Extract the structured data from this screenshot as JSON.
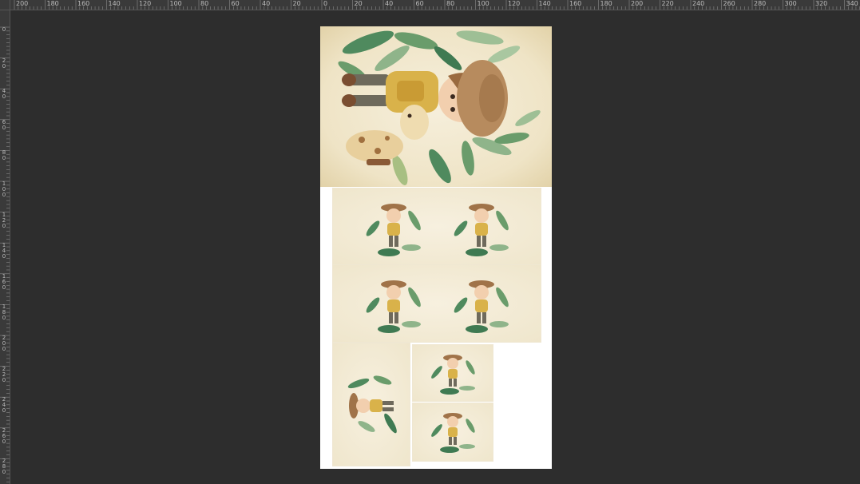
{
  "ruler": {
    "top_labels": [
      "200",
      "180",
      "160",
      "140",
      "120",
      "100",
      "80",
      "60",
      "40",
      "20",
      "0",
      "20",
      "40",
      "60",
      "80",
      "100",
      "120",
      "140",
      "160",
      "180",
      "200",
      "220",
      "240",
      "260",
      "280",
      "300",
      "320",
      "340"
    ],
    "left_labels": [
      "0",
      "20",
      "40",
      "60",
      "80",
      "100",
      "120",
      "140",
      "160",
      "180",
      "200",
      "220",
      "240",
      "260",
      "280"
    ]
  },
  "document": {
    "background": "#ffffff",
    "items": [
      {
        "id": "main-illustration",
        "label": "safari boy with giraffe"
      },
      {
        "id": "card-a1",
        "label": "card"
      },
      {
        "id": "card-a2",
        "label": "card"
      },
      {
        "id": "card-b",
        "label": "card"
      },
      {
        "id": "card-c1",
        "label": "card"
      },
      {
        "id": "card-c2",
        "label": "card"
      }
    ]
  },
  "colors": {
    "workspace": "#2d2d2d",
    "ruler": "#3a3a3a",
    "leaf_dark": "#3f7a52",
    "leaf_light": "#8fb48a",
    "hat": "#b78b5e",
    "shirt": "#d9b24a",
    "skin": "#f2cfae"
  }
}
